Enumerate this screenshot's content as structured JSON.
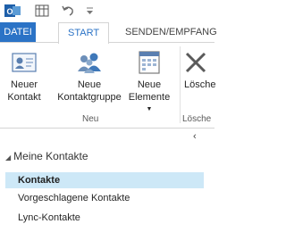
{
  "tabs": {
    "datei": "DATEI",
    "start": "START",
    "senden": "SENDEN/EMPFANG"
  },
  "ribbon": {
    "neuer_kontakt": [
      "Neuer",
      "Kontakt"
    ],
    "neue_kontaktgruppe": [
      "Neue",
      "Kontaktgruppe"
    ],
    "neue_elemente": [
      "Neue",
      "Elemente"
    ],
    "loeschen": "Lösche",
    "group_neu": "Neu",
    "group_loeschen": "Lösche"
  },
  "folders": {
    "section": "Meine Kontakte",
    "items": [
      "Kontakte",
      "Vorgeschlagene Kontakte",
      "Lync-Kontakte"
    ],
    "selected": "Kontakte"
  },
  "colors": {
    "accent": "#2b73c6",
    "selection": "#cde8f7"
  },
  "icons": {
    "app": "outlook-icon",
    "qat1": "send-receive-icon",
    "undo": "undo-icon",
    "qat_more": "customize-arrow-icon",
    "neuer_kontakt": "contact-card-icon",
    "neue_kontaktgruppe": "contact-group-icon",
    "neue_elemente": "new-items-icon",
    "loeschen": "delete-icon"
  }
}
